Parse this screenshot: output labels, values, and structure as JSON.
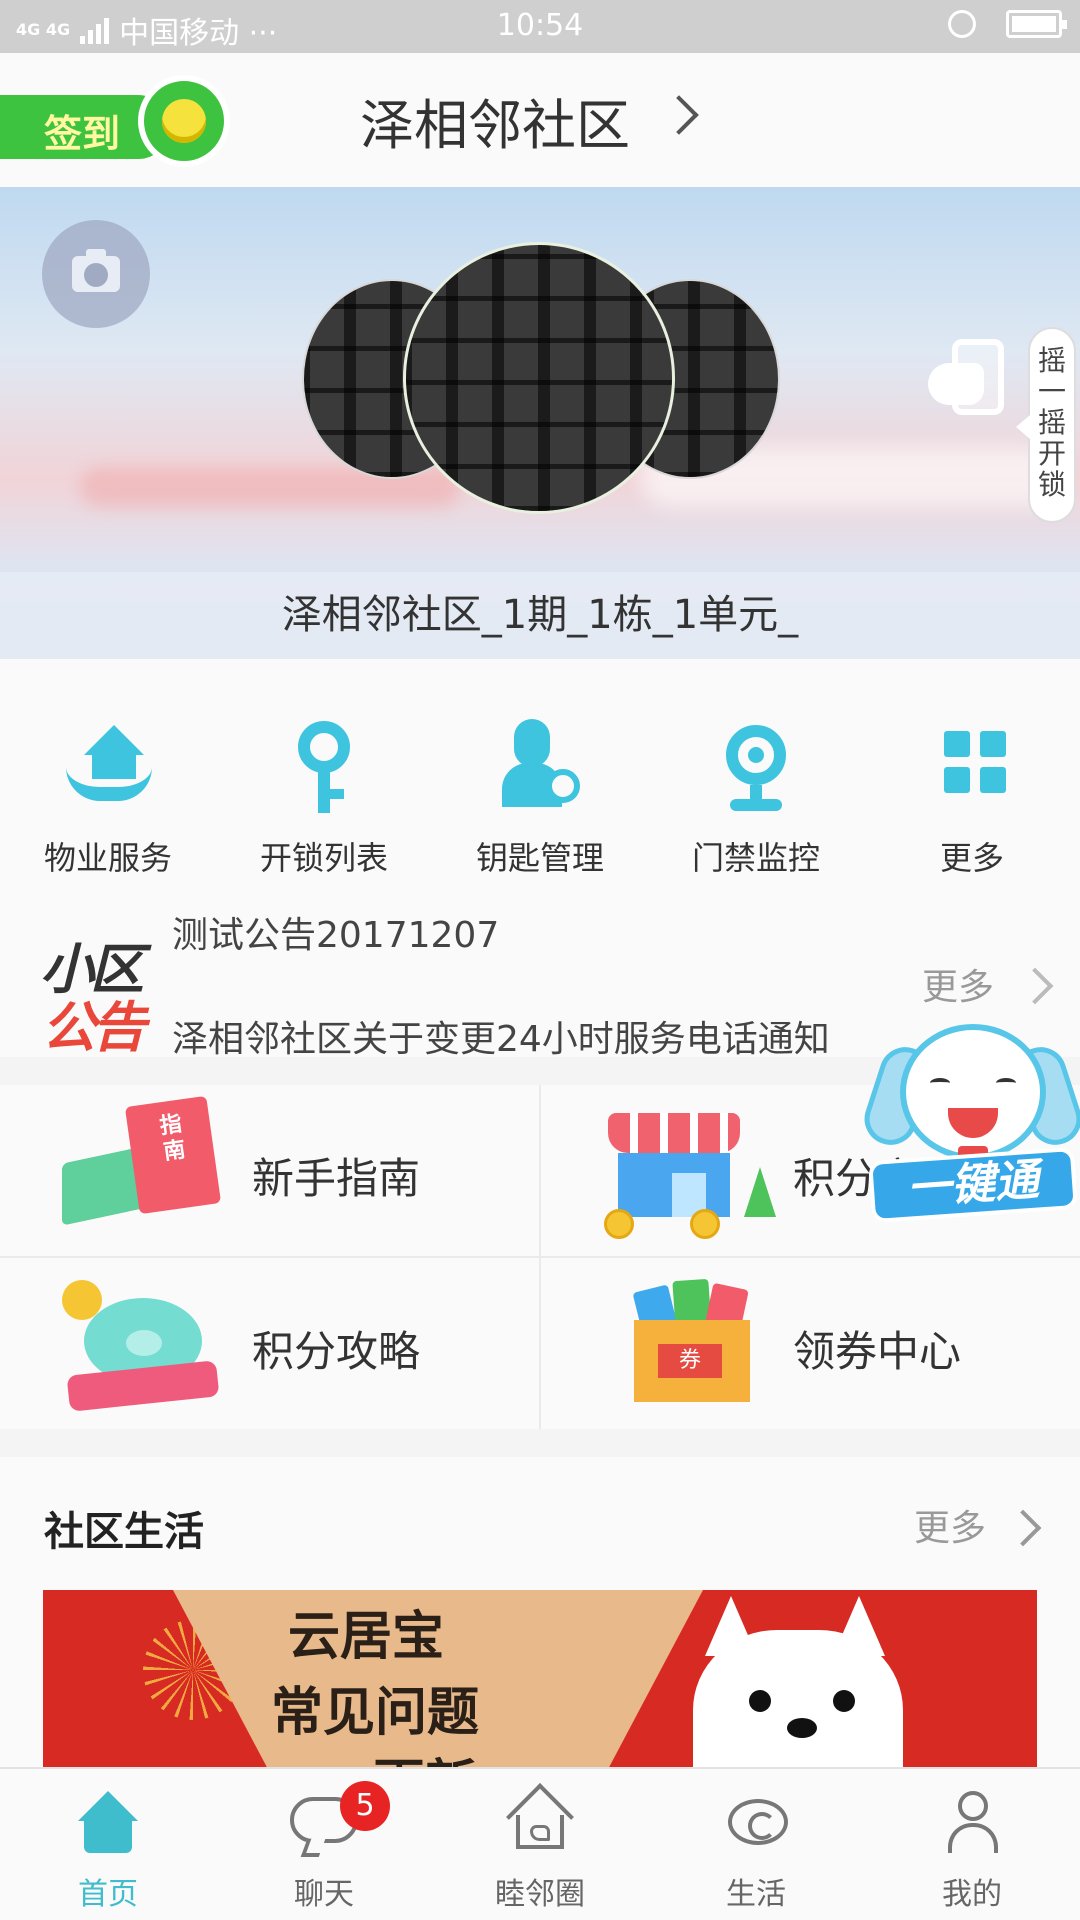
{
  "status_bar": {
    "network": "4G 4G",
    "carrier": "中国移动 ···",
    "time": "10:54"
  },
  "header": {
    "checkin_label": "签到",
    "community_name": "泽相邻社区"
  },
  "banner": {
    "address": "泽相邻社区_1期_1栋_1单元_",
    "shake_label": "摇一摇开锁"
  },
  "services": [
    {
      "label": "物业服务",
      "icon": "house-hand-icon"
    },
    {
      "label": "开锁列表",
      "icon": "key-icon"
    },
    {
      "label": "钥匙管理",
      "icon": "person-key-icon"
    },
    {
      "label": "门禁监控",
      "icon": "webcam-icon"
    },
    {
      "label": "更多",
      "icon": "grid-icon"
    }
  ],
  "notice": {
    "logo_line1": "小区",
    "logo_line2": "公告",
    "item1": "测试公告20171207",
    "item2": "泽相邻社区关于变更24小时服务电话通知",
    "more": "更多"
  },
  "cards": [
    {
      "label": "新手指南"
    },
    {
      "label": "积分商城"
    },
    {
      "label": "积分攻略"
    },
    {
      "label": "领券中心"
    }
  ],
  "mascot": {
    "label": "一键通"
  },
  "life": {
    "title": "社区生活",
    "more": "更多",
    "banner_line1": "云居宝",
    "banner_line2": "常见问题",
    "banner_line3": "更新"
  },
  "tabbar": {
    "tabs": [
      {
        "label": "首页",
        "active": true
      },
      {
        "label": "聊天",
        "badge": "5"
      },
      {
        "label": "睦邻圈"
      },
      {
        "label": "生活"
      },
      {
        "label": "我的"
      }
    ]
  },
  "colors": {
    "accent": "#3fbdcc",
    "service_icon": "#3ec4de",
    "checkin_green": "#3ec340",
    "badge_red": "#e72323"
  }
}
